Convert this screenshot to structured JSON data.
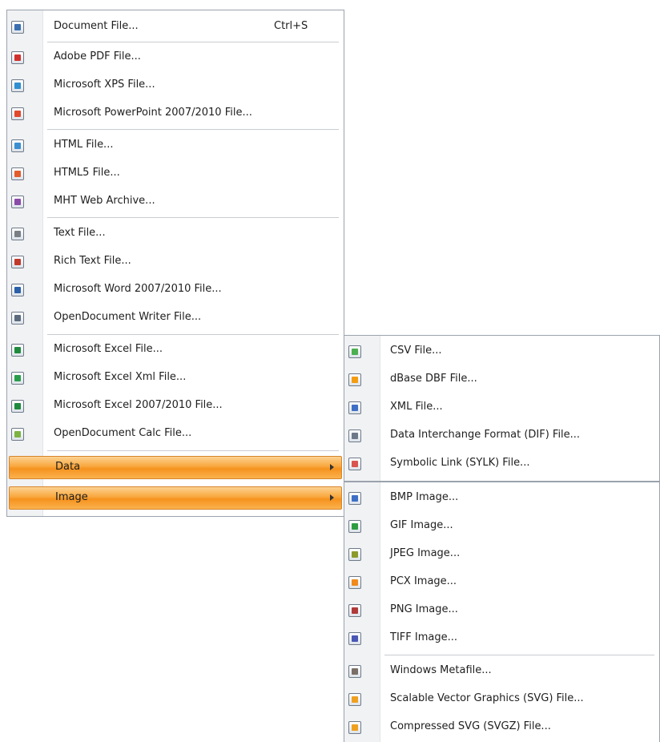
{
  "export_menu": {
    "items": [
      {
        "label": "Document File...",
        "shortcut": "Ctrl+S",
        "icon": "document-file-icon",
        "color": "#3a6fb0"
      },
      {
        "label": "Adobe PDF File...",
        "icon": "pdf-icon",
        "color": "#d0312d"
      },
      {
        "label": "Microsoft XPS File...",
        "icon": "xps-icon",
        "color": "#2f8fd0"
      },
      {
        "label": "Microsoft PowerPoint 2007/2010 File...",
        "icon": "powerpoint-icon",
        "color": "#e0492b"
      },
      {
        "label": "HTML File...",
        "icon": "html-icon",
        "color": "#3b8fd1"
      },
      {
        "label": "HTML5 File...",
        "icon": "html5-icon",
        "color": "#e25b2a"
      },
      {
        "label": "MHT Web Archive...",
        "icon": "mht-icon",
        "color": "#8a4aa8"
      },
      {
        "label": "Text File...",
        "icon": "text-file-icon",
        "color": "#7a7f86"
      },
      {
        "label": "Rich Text File...",
        "icon": "rich-text-icon",
        "color": "#c0392b"
      },
      {
        "label": "Microsoft Word 2007/2010 File...",
        "icon": "word-icon",
        "color": "#2b5fa8"
      },
      {
        "label": "OpenDocument Writer File...",
        "icon": "odt-icon",
        "color": "#5b6b7d"
      },
      {
        "label": "Microsoft Excel File...",
        "icon": "excel-icon",
        "color": "#1f8a3b"
      },
      {
        "label": "Microsoft Excel Xml File...",
        "icon": "excel-xml-icon",
        "color": "#2a9d4a"
      },
      {
        "label": "Microsoft Excel 2007/2010 File...",
        "icon": "excel-2007-icon",
        "color": "#1f8a3b"
      },
      {
        "label": "OpenDocument Calc File...",
        "icon": "ods-icon",
        "color": "#7cb342"
      }
    ],
    "data_label": "Data",
    "image_label": "Image"
  },
  "data_submenu": {
    "items": [
      {
        "label": "CSV File...",
        "icon": "csv-icon",
        "color": "#4caf50"
      },
      {
        "label": "dBase DBF File...",
        "icon": "dbf-icon",
        "color": "#f39c12"
      },
      {
        "label": "XML File...",
        "icon": "xml-icon",
        "color": "#3f6fc5"
      },
      {
        "label": "Data Interchange Format (DIF) File...",
        "icon": "dif-icon",
        "color": "#6e7a89"
      },
      {
        "label": "Symbolic Link (SYLK) File...",
        "icon": "sylk-icon",
        "color": "#d9534f"
      }
    ]
  },
  "image_submenu": {
    "items": [
      {
        "label": "BMP Image...",
        "icon": "bmp-icon",
        "color": "#3f6fc5"
      },
      {
        "label": "GIF Image...",
        "icon": "gif-icon",
        "color": "#2e9d42"
      },
      {
        "label": "JPEG Image...",
        "icon": "jpeg-icon",
        "color": "#8c9a2b"
      },
      {
        "label": "PCX Image...",
        "icon": "pcx-icon",
        "color": "#f08a1c"
      },
      {
        "label": "PNG Image...",
        "icon": "png-icon",
        "color": "#b03a3a"
      },
      {
        "label": "TIFF Image...",
        "icon": "tiff-icon",
        "color": "#4a57b5"
      },
      {
        "label": "Windows Metafile...",
        "icon": "wmf-icon",
        "color": "#7a6e66"
      },
      {
        "label": "Scalable Vector Graphics (SVG) File...",
        "icon": "svg-icon",
        "color": "#f0a020"
      },
      {
        "label": "Compressed SVG (SVGZ) File...",
        "icon": "svgz-icon",
        "color": "#f0a020"
      }
    ]
  }
}
